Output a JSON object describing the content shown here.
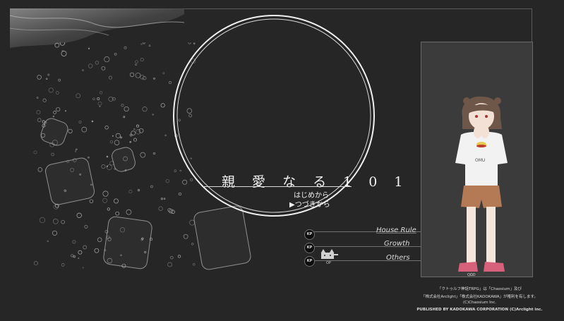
{
  "title": {
    "text": "親 愛 な る 1 0 1"
  },
  "menu": {
    "start_label": "はじめから",
    "continue_label": "▶つづきから"
  },
  "side_menu": [
    {
      "badge": "KP",
      "label": "House Rule"
    },
    {
      "badge": "KP",
      "label": "Growth"
    },
    {
      "badge": "KP",
      "label": "Others"
    }
  ],
  "mascot": {
    "caption": "OP"
  },
  "character": {
    "shirt_text": "OMU",
    "name_tag": "QΩD"
  },
  "credits": {
    "line1": "「クトゥルフ神話TRPG」は「Chaosium」及び",
    "line2": "「株式会社Arclight」「株式会社KADOKAWA」が権利を有します。",
    "line3": "(C)Chaosium Inc.",
    "line4": "PUBLISHED BY KADOKAWA CORPORATION (C)Arclight inc."
  },
  "colors": {
    "background": "#262626",
    "ring": "#f0f0f0",
    "frame": "#5a5a5a"
  }
}
